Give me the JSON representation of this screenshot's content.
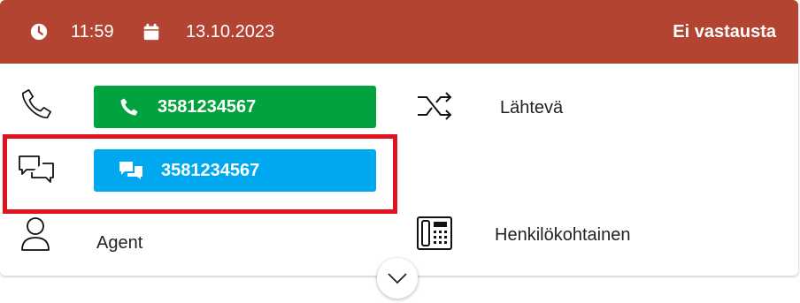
{
  "header": {
    "time": "11:59",
    "date": "13.10.2023",
    "status": "Ei vastausta",
    "time_icon": "clock-icon",
    "date_icon": "calendar-icon"
  },
  "rows": {
    "phone": {
      "icon": "phone-icon",
      "number": "3581234567",
      "button_color": "#00a33d"
    },
    "direction": {
      "icon": "shuffle-icon",
      "label": "Lähtevä"
    },
    "chat": {
      "icon": "chat-bubbles-icon",
      "number": "3581234567",
      "button_color": "#00a8f0"
    },
    "agent": {
      "icon": "user-icon",
      "label": "Agent"
    },
    "line": {
      "icon": "desk-phone-icon",
      "label": "Henkilökohtainen"
    }
  },
  "colors": {
    "header": "#b34431",
    "highlight": "#e0141e"
  },
  "expand": {
    "icon": "chevron-down-icon"
  }
}
